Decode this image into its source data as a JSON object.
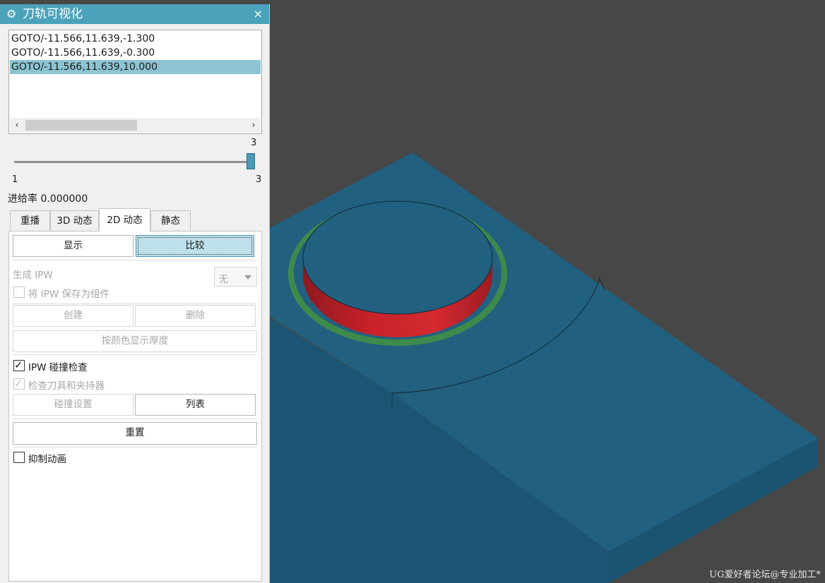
{
  "dialog": {
    "title": "刀轨可视化",
    "icon": "gear-icon",
    "close_icon": "×"
  },
  "list": {
    "items": [
      "GOTO/-11.566,11.639,-1.300",
      "GOTO/-11.566,11.639,-0.300",
      "GOTO/-11.566,11.639,10.000"
    ],
    "selected_index": 2
  },
  "slider": {
    "current": "3",
    "min": "1",
    "max": "3",
    "position_fraction": 1.0
  },
  "feed_rate": "进给率 0.000000",
  "tabs": [
    "重播",
    "3D 动态",
    "2D 动态",
    "静态"
  ],
  "active_tab": "2D 动态",
  "panel": {
    "show_button": "显示",
    "compare_button": "比较",
    "generate_ipw_label": "生成 IPW",
    "generate_ipw_value": "无",
    "save_ipw_label": "将 IPW 保存为组件",
    "create_button": "创建",
    "delete_button": "删除",
    "thickness_button": "按颜色显示厚度",
    "collision_check_label": "IPW 碰撞检查",
    "collision_check_checked": true,
    "check_tool_label": "检查刀具和夹持器",
    "check_tool_checked": true,
    "collision_settings_button": "碰撞设置",
    "list_button": "列表",
    "reset_button": "重置",
    "suppress_anim_label": "抑制动画",
    "suppress_anim_checked": false
  },
  "viewport": {
    "background_color": "#474747",
    "block_color": "#22607f",
    "green_ring_color": "#3d8a4b",
    "red_wall_color": "#c62028",
    "watermark": "UG爱好者论坛@专业加工*"
  }
}
